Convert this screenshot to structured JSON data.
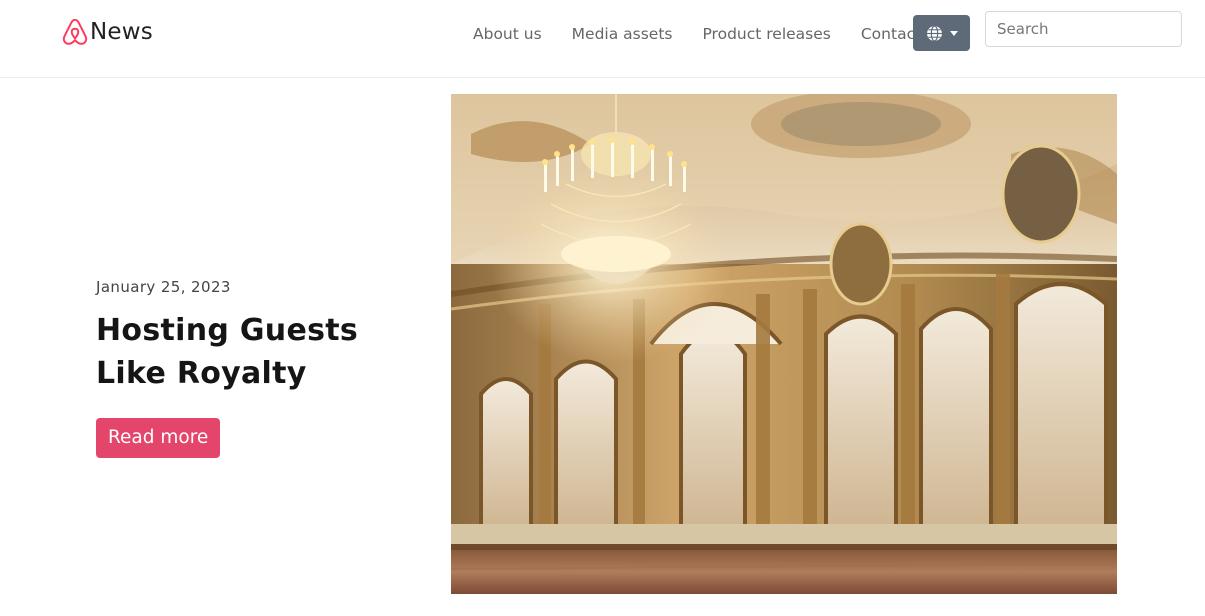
{
  "header": {
    "brand_text": "News",
    "nav": [
      {
        "label": "About us"
      },
      {
        "label": "Media assets"
      },
      {
        "label": "Product releases"
      },
      {
        "label": "Contact"
      }
    ],
    "language_icon": "globe-icon",
    "search_placeholder": "Search"
  },
  "hero": {
    "date": "January 25, 2023",
    "title": "Hosting Guests Like Royalty",
    "cta_label": "Read more",
    "image_subject": "ornate palace ballroom with crystal chandelier"
  },
  "colors": {
    "accent": "#e4456a",
    "brand": "#ff385c",
    "language_button": "#5e6a77"
  }
}
